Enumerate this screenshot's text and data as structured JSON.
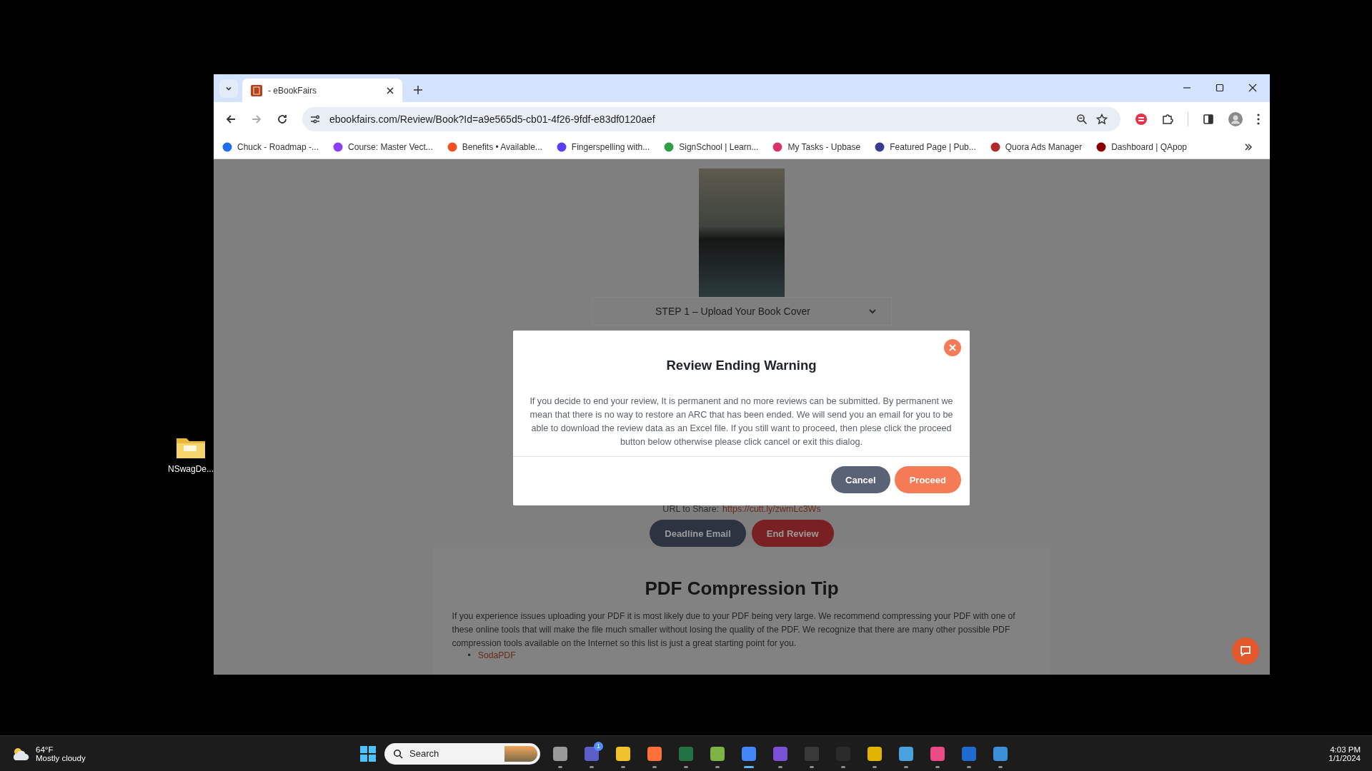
{
  "browser": {
    "tabs": [
      {
        "title": "- eBookFairs",
        "selected": true
      }
    ],
    "url": "ebookfairs.com/Review/Book?Id=a9e565d5-cb01-4f26-9fdf-e83df0120aef",
    "bookmarks": [
      {
        "label": "Chuck - Roadmap -..."
      },
      {
        "label": "Course: Master Vect..."
      },
      {
        "label": "Benefits • Available..."
      },
      {
        "label": "Fingerspelling with..."
      },
      {
        "label": "SignSchool | Learn..."
      },
      {
        "label": "My Tasks - Upbase"
      },
      {
        "label": "Featured Page | Pub..."
      },
      {
        "label": "Quora Ads Manager"
      },
      {
        "label": "Dashboard | QApop"
      }
    ]
  },
  "page": {
    "step_title": "STEP 1 – Upload Your Book Cover",
    "share_label": "URL to Share:",
    "share_url": "https://cutt.ly/zwmLc3Ws",
    "buttons": [
      {
        "label": "Deadline Email",
        "kind": "secondary"
      },
      {
        "label": "End Review",
        "kind": "danger"
      }
    ],
    "tip": {
      "title": "PDF Compression Tip",
      "text": "If you experience issues uploading your PDF it is most likely due to your PDF being very large. We recommend compressing your PDF with one of these online tools that will make the file much smaller without losing the quality of the PDF. We recognize that there are many other possible PDF compression tools available on the Internet so this list is just a great starting point for you.",
      "links": [
        {
          "bullet": "•",
          "label": "SodaPDF"
        }
      ]
    }
  },
  "dialog": {
    "title": "Review Ending Warning",
    "body": "If you decide to end your review, It is permanent and no more reviews can be submitted. By permanent we mean that there is no way to restore an ARC that has been ended. We will send you an email for you to be able to download the review data as an Excel file. If you still want to proceed, then plese click the proceed button below otherwise please click cancel or exit this dialog.",
    "buttons": [
      {
        "label": "Cancel",
        "kind": "secondary"
      },
      {
        "label": "Proceed",
        "kind": "primary"
      }
    ]
  },
  "desktop_icons": [
    {
      "label": "NSwagDe..."
    }
  ],
  "taskbar": {
    "weather": {
      "temperature": "64°F",
      "condition": "Mostly cloudy"
    },
    "search": {
      "placeholder": "Search"
    },
    "chat_badge": "1",
    "clock": {
      "time": "4:03 PM",
      "date": "1/1/2024"
    }
  }
}
